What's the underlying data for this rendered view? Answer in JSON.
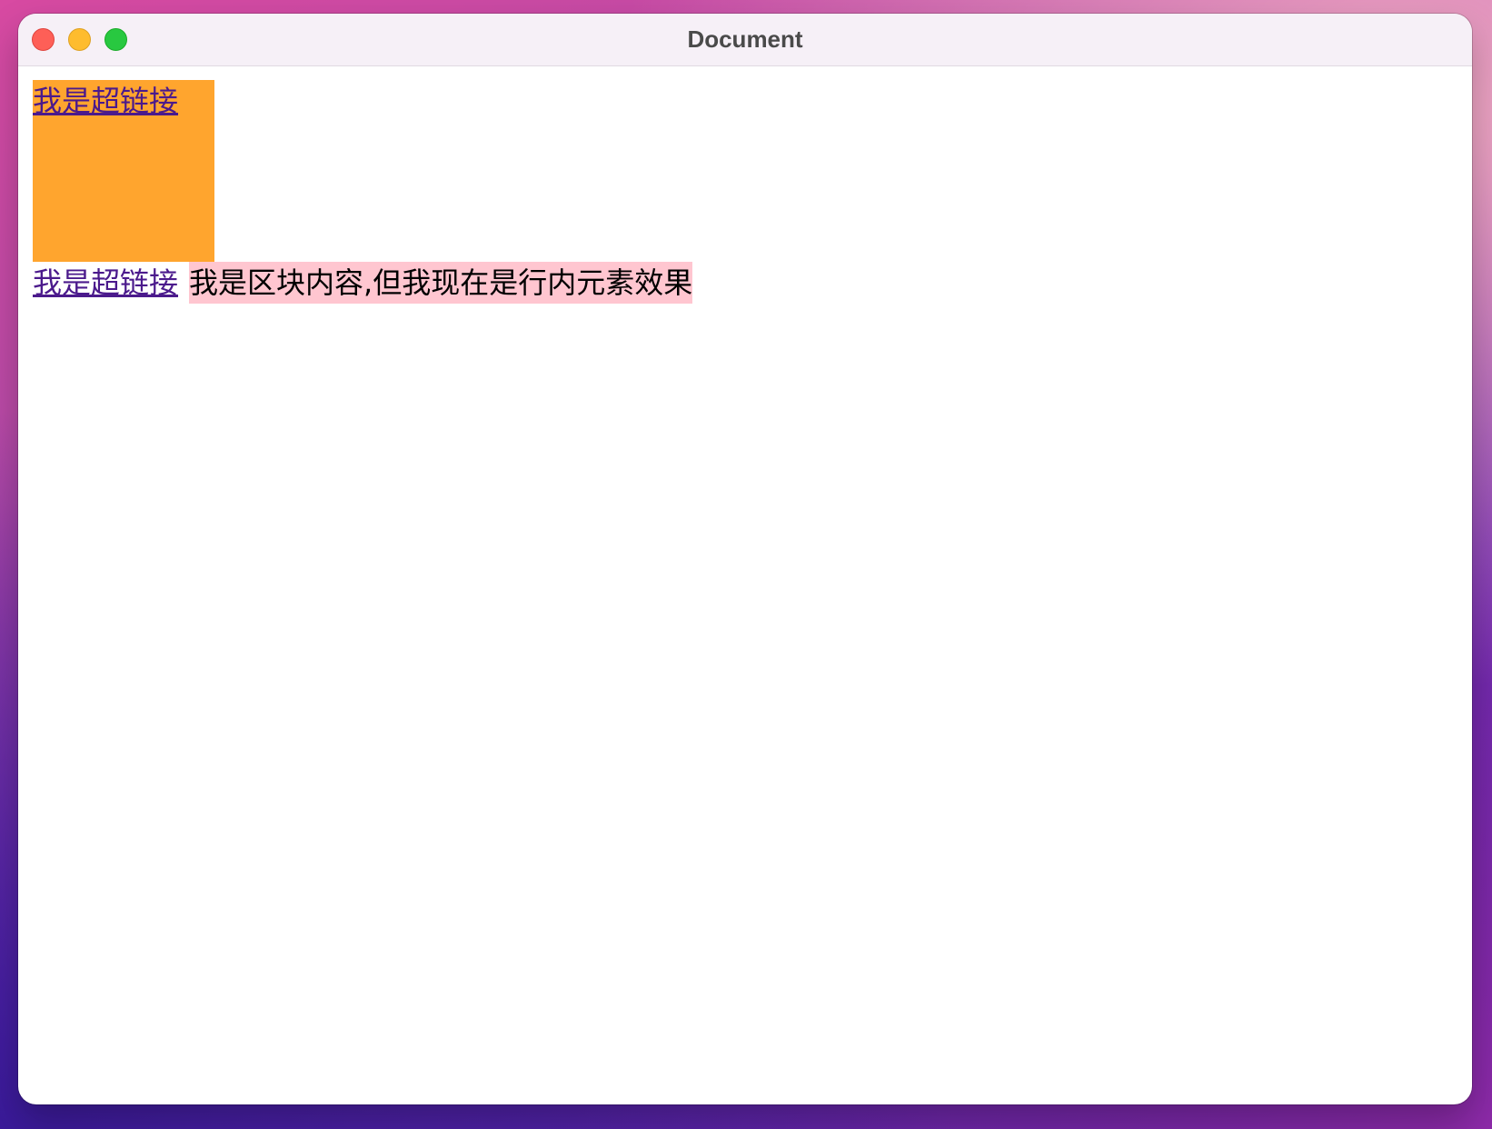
{
  "window": {
    "title": "Document"
  },
  "content": {
    "block_link_text": "我是超链接",
    "inline_link_text": "我是超链接",
    "inline_div_text": "我是区块内容,但我现在是行内元素效果"
  },
  "colors": {
    "block_link_bg": "#ffa52e",
    "inline_div_bg": "#ffc6d0",
    "link_color": "#4b1a8c"
  }
}
